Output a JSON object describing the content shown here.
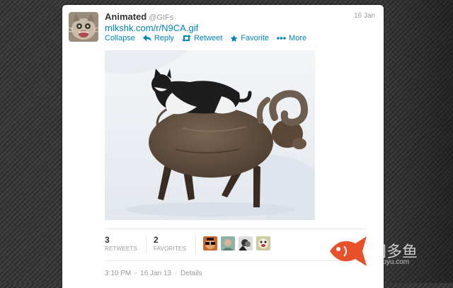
{
  "tweet": {
    "name": "Animated",
    "handle": "@GIFs",
    "date": "16 Jan",
    "link": "mlkshk.com/r/N9CA.gif",
    "actions": {
      "collapse": "Collapse",
      "reply": "Reply",
      "retweet": "Retweet",
      "favorite": "Favorite",
      "more": "More"
    },
    "stats": {
      "retweets_count": "3",
      "retweets_label": "RETWEETS",
      "favorites_count": "2",
      "favorites_label": "FAVORITES"
    },
    "timestamp": {
      "time": "3:10 PM",
      "separator": "-",
      "date": "16 Jan 13",
      "dot": "·",
      "details": "Details"
    }
  },
  "colors": {
    "link": "#0084b4",
    "muted": "#999999",
    "watermark_fish": "#e8502a"
  },
  "watermark": {
    "text": "网多鱼",
    "sub": "wduoyu.com"
  }
}
